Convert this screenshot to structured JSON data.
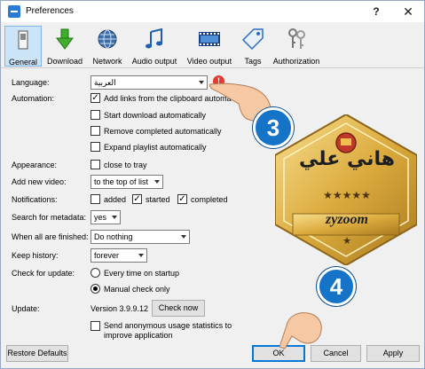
{
  "window": {
    "title": "Preferences",
    "help": "?",
    "close": "✕"
  },
  "toolbar": [
    {
      "id": "general",
      "label": "General"
    },
    {
      "id": "download",
      "label": "Download"
    },
    {
      "id": "network",
      "label": "Network"
    },
    {
      "id": "audio",
      "label": "Audio output"
    },
    {
      "id": "video",
      "label": "Video output"
    },
    {
      "id": "tags",
      "label": "Tags"
    },
    {
      "id": "authorization",
      "label": "Authorization"
    }
  ],
  "general": {
    "language": {
      "label": "Language:",
      "value": "العربية"
    },
    "automation": {
      "label": "Automation:",
      "options": [
        {
          "label": "Add links from the clipboard automa",
          "checked": true
        },
        {
          "label": "Start download automatically",
          "checked": false
        },
        {
          "label": "Remove completed automatically",
          "checked": false
        },
        {
          "label": "Expand playlist automatically",
          "checked": false
        }
      ]
    },
    "appearance": {
      "label": "Appearance:",
      "option": "close to tray",
      "checked": false
    },
    "add_new_video": {
      "label": "Add new video:",
      "value": "to the top of list"
    },
    "notifications": {
      "label": "Notifications:",
      "options": [
        {
          "label": "added",
          "checked": false
        },
        {
          "label": "started",
          "checked": true
        },
        {
          "label": "completed",
          "checked": true
        }
      ]
    },
    "search_metadata": {
      "label": "Search for metadata:",
      "value": "yes"
    },
    "when_finished": {
      "label": "When all are finished:",
      "value": "Do nothing"
    },
    "keep_history": {
      "label": "Keep history:",
      "value": "forever"
    },
    "check_update": {
      "label": "Check for update:",
      "options": [
        {
          "label": "Every time on startup",
          "selected": false
        },
        {
          "label": "Manual check only",
          "selected": true
        }
      ]
    },
    "update": {
      "label": "Update:",
      "version": "Version 3.9.9.12",
      "button": "Check now"
    },
    "stats": {
      "line1": "Send anonymous usage statistics to",
      "line2": "improve application",
      "checked": false
    }
  },
  "footer": {
    "restore": "Restore Defaults",
    "ok": "OK",
    "cancel": "Cancel",
    "apply": "Apply"
  },
  "watermark": {
    "name": "هاني علي",
    "stars": "★★★★★",
    "brand": "zyzoom",
    "star": "★"
  },
  "badges": [
    "3",
    "4"
  ],
  "colors": {
    "accent": "#0078d7",
    "badge": "#1573c8",
    "gold": "#e2b64a"
  }
}
